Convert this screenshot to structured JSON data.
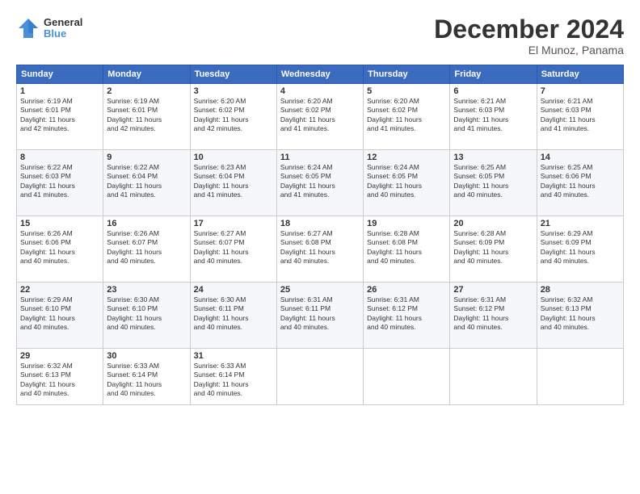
{
  "header": {
    "logo_line1": "General",
    "logo_line2": "Blue",
    "month": "December 2024",
    "location": "El Munoz, Panama"
  },
  "days_of_week": [
    "Sunday",
    "Monday",
    "Tuesday",
    "Wednesday",
    "Thursday",
    "Friday",
    "Saturday"
  ],
  "weeks": [
    [
      {
        "day": "1",
        "info": "Sunrise: 6:19 AM\nSunset: 6:01 PM\nDaylight: 11 hours\nand 42 minutes."
      },
      {
        "day": "2",
        "info": "Sunrise: 6:19 AM\nSunset: 6:01 PM\nDaylight: 11 hours\nand 42 minutes."
      },
      {
        "day": "3",
        "info": "Sunrise: 6:20 AM\nSunset: 6:02 PM\nDaylight: 11 hours\nand 42 minutes."
      },
      {
        "day": "4",
        "info": "Sunrise: 6:20 AM\nSunset: 6:02 PM\nDaylight: 11 hours\nand 41 minutes."
      },
      {
        "day": "5",
        "info": "Sunrise: 6:20 AM\nSunset: 6:02 PM\nDaylight: 11 hours\nand 41 minutes."
      },
      {
        "day": "6",
        "info": "Sunrise: 6:21 AM\nSunset: 6:03 PM\nDaylight: 11 hours\nand 41 minutes."
      },
      {
        "day": "7",
        "info": "Sunrise: 6:21 AM\nSunset: 6:03 PM\nDaylight: 11 hours\nand 41 minutes."
      }
    ],
    [
      {
        "day": "8",
        "info": "Sunrise: 6:22 AM\nSunset: 6:03 PM\nDaylight: 11 hours\nand 41 minutes."
      },
      {
        "day": "9",
        "info": "Sunrise: 6:22 AM\nSunset: 6:04 PM\nDaylight: 11 hours\nand 41 minutes."
      },
      {
        "day": "10",
        "info": "Sunrise: 6:23 AM\nSunset: 6:04 PM\nDaylight: 11 hours\nand 41 minutes."
      },
      {
        "day": "11",
        "info": "Sunrise: 6:24 AM\nSunset: 6:05 PM\nDaylight: 11 hours\nand 41 minutes."
      },
      {
        "day": "12",
        "info": "Sunrise: 6:24 AM\nSunset: 6:05 PM\nDaylight: 11 hours\nand 40 minutes."
      },
      {
        "day": "13",
        "info": "Sunrise: 6:25 AM\nSunset: 6:05 PM\nDaylight: 11 hours\nand 40 minutes."
      },
      {
        "day": "14",
        "info": "Sunrise: 6:25 AM\nSunset: 6:06 PM\nDaylight: 11 hours\nand 40 minutes."
      }
    ],
    [
      {
        "day": "15",
        "info": "Sunrise: 6:26 AM\nSunset: 6:06 PM\nDaylight: 11 hours\nand 40 minutes."
      },
      {
        "day": "16",
        "info": "Sunrise: 6:26 AM\nSunset: 6:07 PM\nDaylight: 11 hours\nand 40 minutes."
      },
      {
        "day": "17",
        "info": "Sunrise: 6:27 AM\nSunset: 6:07 PM\nDaylight: 11 hours\nand 40 minutes."
      },
      {
        "day": "18",
        "info": "Sunrise: 6:27 AM\nSunset: 6:08 PM\nDaylight: 11 hours\nand 40 minutes."
      },
      {
        "day": "19",
        "info": "Sunrise: 6:28 AM\nSunset: 6:08 PM\nDaylight: 11 hours\nand 40 minutes."
      },
      {
        "day": "20",
        "info": "Sunrise: 6:28 AM\nSunset: 6:09 PM\nDaylight: 11 hours\nand 40 minutes."
      },
      {
        "day": "21",
        "info": "Sunrise: 6:29 AM\nSunset: 6:09 PM\nDaylight: 11 hours\nand 40 minutes."
      }
    ],
    [
      {
        "day": "22",
        "info": "Sunrise: 6:29 AM\nSunset: 6:10 PM\nDaylight: 11 hours\nand 40 minutes."
      },
      {
        "day": "23",
        "info": "Sunrise: 6:30 AM\nSunset: 6:10 PM\nDaylight: 11 hours\nand 40 minutes."
      },
      {
        "day": "24",
        "info": "Sunrise: 6:30 AM\nSunset: 6:11 PM\nDaylight: 11 hours\nand 40 minutes."
      },
      {
        "day": "25",
        "info": "Sunrise: 6:31 AM\nSunset: 6:11 PM\nDaylight: 11 hours\nand 40 minutes."
      },
      {
        "day": "26",
        "info": "Sunrise: 6:31 AM\nSunset: 6:12 PM\nDaylight: 11 hours\nand 40 minutes."
      },
      {
        "day": "27",
        "info": "Sunrise: 6:31 AM\nSunset: 6:12 PM\nDaylight: 11 hours\nand 40 minutes."
      },
      {
        "day": "28",
        "info": "Sunrise: 6:32 AM\nSunset: 6:13 PM\nDaylight: 11 hours\nand 40 minutes."
      }
    ],
    [
      {
        "day": "29",
        "info": "Sunrise: 6:32 AM\nSunset: 6:13 PM\nDaylight: 11 hours\nand 40 minutes."
      },
      {
        "day": "30",
        "info": "Sunrise: 6:33 AM\nSunset: 6:14 PM\nDaylight: 11 hours\nand 40 minutes."
      },
      {
        "day": "31",
        "info": "Sunrise: 6:33 AM\nSunset: 6:14 PM\nDaylight: 11 hours\nand 40 minutes."
      },
      null,
      null,
      null,
      null
    ]
  ]
}
